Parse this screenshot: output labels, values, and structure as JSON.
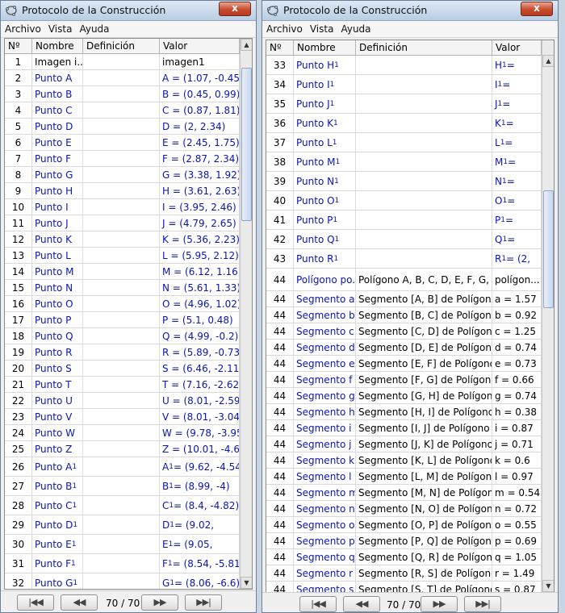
{
  "left_window": {
    "title": "Protocolo de la Construcción",
    "close_label": "x",
    "menu": [
      "Archivo",
      "Vista",
      "Ayuda"
    ],
    "columns": [
      "Nº",
      "Nombre",
      "Definición",
      "Valor"
    ],
    "rows": [
      {
        "n": "1",
        "name": "Imagen i...",
        "base": "",
        "sub": "",
        "def": "",
        "val": "imagen1",
        "vbase": "",
        "vrest": ""
      },
      {
        "n": "2",
        "name": "Punto A",
        "base": "",
        "sub": "",
        "def": "",
        "val": "A = (1.07, -0.45)",
        "vbase": "",
        "vrest": ""
      },
      {
        "n": "3",
        "name": "Punto B",
        "base": "",
        "sub": "",
        "def": "",
        "val": "B = (0.45, 0.99)",
        "vbase": "",
        "vrest": ""
      },
      {
        "n": "4",
        "name": "Punto C",
        "base": "",
        "sub": "",
        "def": "",
        "val": "C = (0.87, 1.81)",
        "vbase": "",
        "vrest": ""
      },
      {
        "n": "5",
        "name": "Punto D",
        "base": "",
        "sub": "",
        "def": "",
        "val": "D = (2, 2.34)",
        "vbase": "",
        "vrest": ""
      },
      {
        "n": "6",
        "name": "Punto E",
        "base": "",
        "sub": "",
        "def": "",
        "val": "E = (2.45, 1.75)",
        "vbase": "",
        "vrest": ""
      },
      {
        "n": "7",
        "name": "Punto F",
        "base": "",
        "sub": "",
        "def": "",
        "val": "F = (2.87, 2.34)",
        "vbase": "",
        "vrest": ""
      },
      {
        "n": "8",
        "name": "Punto G",
        "base": "",
        "sub": "",
        "def": "",
        "val": "G = (3.38, 1.92)",
        "vbase": "",
        "vrest": ""
      },
      {
        "n": "9",
        "name": "Punto H",
        "base": "",
        "sub": "",
        "def": "",
        "val": "H = (3.61, 2.63)",
        "vbase": "",
        "vrest": ""
      },
      {
        "n": "10",
        "name": "Punto I",
        "base": "",
        "sub": "",
        "def": "",
        "val": "I = (3.95, 2.46)",
        "vbase": "",
        "vrest": ""
      },
      {
        "n": "11",
        "name": "Punto J",
        "base": "",
        "sub": "",
        "def": "",
        "val": "J = (4.79, 2.65)",
        "vbase": "",
        "vrest": ""
      },
      {
        "n": "12",
        "name": "Punto K",
        "base": "",
        "sub": "",
        "def": "",
        "val": "K = (5.36, 2.23)",
        "vbase": "",
        "vrest": ""
      },
      {
        "n": "13",
        "name": "Punto L",
        "base": "",
        "sub": "",
        "def": "",
        "val": "L = (5.95, 2.12)",
        "vbase": "",
        "vrest": ""
      },
      {
        "n": "14",
        "name": "Punto M",
        "base": "",
        "sub": "",
        "def": "",
        "val": "M = (6.12, 1.16)",
        "vbase": "",
        "vrest": ""
      },
      {
        "n": "15",
        "name": "Punto N",
        "base": "",
        "sub": "",
        "def": "",
        "val": "N = (5.61, 1.33)",
        "vbase": "",
        "vrest": ""
      },
      {
        "n": "16",
        "name": "Punto O",
        "base": "",
        "sub": "",
        "def": "",
        "val": "O = (4.96, 1.02)",
        "vbase": "",
        "vrest": ""
      },
      {
        "n": "17",
        "name": "Punto P",
        "base": "",
        "sub": "",
        "def": "",
        "val": "P = (5.1, 0.48)",
        "vbase": "",
        "vrest": ""
      },
      {
        "n": "18",
        "name": "Punto Q",
        "base": "",
        "sub": "",
        "def": "",
        "val": "Q = (4.99, -0.2)",
        "vbase": "",
        "vrest": ""
      },
      {
        "n": "19",
        "name": "Punto R",
        "base": "",
        "sub": "",
        "def": "",
        "val": "R = (5.89, -0.73)",
        "vbase": "",
        "vrest": ""
      },
      {
        "n": "20",
        "name": "Punto S",
        "base": "",
        "sub": "",
        "def": "",
        "val": "S = (6.46, -2.11)",
        "vbase": "",
        "vrest": ""
      },
      {
        "n": "21",
        "name": "Punto T",
        "base": "",
        "sub": "",
        "def": "",
        "val": "T = (7.16, -2.62)",
        "vbase": "",
        "vrest": ""
      },
      {
        "n": "22",
        "name": "Punto U",
        "base": "",
        "sub": "",
        "def": "",
        "val": "U = (8.01, -2.59)",
        "vbase": "",
        "vrest": ""
      },
      {
        "n": "23",
        "name": "Punto V",
        "base": "",
        "sub": "",
        "def": "",
        "val": "V = (8.01, -3.04)",
        "vbase": "",
        "vrest": ""
      },
      {
        "n": "24",
        "name": "Punto W",
        "base": "",
        "sub": "",
        "def": "",
        "val": "W = (9.78, -3.95)",
        "vbase": "",
        "vrest": ""
      },
      {
        "n": "25",
        "name": "Punto Z",
        "base": "",
        "sub": "",
        "def": "",
        "val": "Z = (10.01, -4.6)",
        "vbase": "",
        "vrest": ""
      },
      {
        "n": "26",
        "name": "",
        "base": "Punto A",
        "sub": "1",
        "def": "",
        "val": "",
        "vbase": "A",
        "vrest": " = (9.62, -4.54)"
      },
      {
        "n": "27",
        "name": "",
        "base": "Punto B",
        "sub": "1",
        "def": "",
        "val": "",
        "vbase": "B",
        "vrest": " = (8.99, -4)"
      },
      {
        "n": "28",
        "name": "",
        "base": "Punto C",
        "sub": "1",
        "def": "",
        "val": "",
        "vbase": "C",
        "vrest": " = (8.4, -4.82)"
      },
      {
        "n": "29",
        "name": "",
        "base": "Punto D",
        "sub": "1",
        "def": "",
        "val": "",
        "vbase": "D",
        "vrest": " = (9.02,"
      },
      {
        "n": "30",
        "name": "",
        "base": "Punto E",
        "sub": "1",
        "def": "",
        "val": "",
        "vbase": "E",
        "vrest": " = (9.05,"
      },
      {
        "n": "31",
        "name": "",
        "base": "Punto F",
        "sub": "1",
        "def": "",
        "val": "",
        "vbase": "F",
        "vrest": " = (8.54, -5.81)"
      },
      {
        "n": "32",
        "name": "",
        "base": "Punto G",
        "sub": "1",
        "def": "",
        "val": "",
        "vbase": "G",
        "vrest": " = (8.06, -6.6)"
      }
    ],
    "nav": {
      "first": "|◀◀",
      "prev": "◀◀",
      "counter": "70 / 70",
      "next": "▶▶",
      "last": "▶▶|"
    }
  },
  "right_window": {
    "title": "Protocolo de la Construcción",
    "close_label": "x",
    "menu": [
      "Archivo",
      "Vista",
      "Ayuda"
    ],
    "columns": [
      "Nº",
      "Nombre",
      "Definición",
      "Valor"
    ],
    "rows": [
      {
        "n": "33",
        "name": "",
        "base": "Punto H",
        "sub": "1",
        "def": "",
        "val": "",
        "vbase": "H",
        "vrest": " ="
      },
      {
        "n": "34",
        "name": "",
        "base": "Punto I",
        "sub": "1",
        "def": "",
        "val": "",
        "vbase": "I",
        "vrest": " ="
      },
      {
        "n": "35",
        "name": "",
        "base": "Punto J",
        "sub": "1",
        "def": "",
        "val": "",
        "vbase": "J",
        "vrest": " ="
      },
      {
        "n": "36",
        "name": "",
        "base": "Punto K",
        "sub": "1",
        "def": "",
        "val": "",
        "vbase": "K",
        "vrest": " ="
      },
      {
        "n": "37",
        "name": "",
        "base": "Punto L",
        "sub": "1",
        "def": "",
        "val": "",
        "vbase": "L",
        "vrest": " ="
      },
      {
        "n": "38",
        "name": "",
        "base": "Punto M",
        "sub": "1",
        "def": "",
        "val": "",
        "vbase": "M",
        "vrest": " ="
      },
      {
        "n": "39",
        "name": "",
        "base": "Punto N",
        "sub": "1",
        "def": "",
        "val": "",
        "vbase": "N",
        "vrest": " ="
      },
      {
        "n": "40",
        "name": "",
        "base": "Punto O",
        "sub": "1",
        "def": "",
        "val": "",
        "vbase": "O",
        "vrest": " ="
      },
      {
        "n": "41",
        "name": "",
        "base": "Punto P",
        "sub": "1",
        "def": "",
        "val": "",
        "vbase": "P",
        "vrest": " ="
      },
      {
        "n": "42",
        "name": "",
        "base": "Punto Q",
        "sub": "1",
        "def": "",
        "val": "",
        "vbase": "Q",
        "vrest": " ="
      },
      {
        "n": "43",
        "name": "",
        "base": "Punto R",
        "sub": "1",
        "def": "",
        "val": "",
        "vbase": "R",
        "vrest": " = (2,"
      },
      {
        "n": "44",
        "name": "Polígono po...",
        "base": "",
        "sub": "",
        "def": "Polígono A, B, C, D, E, F, G, H,",
        "val": "polígon...",
        "vbase": "",
        "vrest": ""
      },
      {
        "n": "44",
        "name": "Segmento a",
        "base": "",
        "sub": "",
        "def": "Segmento [A, B] de Polígono",
        "val": "a = 1.57",
        "vbase": "",
        "vrest": ""
      },
      {
        "n": "44",
        "name": "Segmento b",
        "base": "",
        "sub": "",
        "def": "Segmento [B, C] de Polígono",
        "val": "b = 0.92",
        "vbase": "",
        "vrest": ""
      },
      {
        "n": "44",
        "name": "Segmento c",
        "base": "",
        "sub": "",
        "def": "Segmento [C, D] de Polígono",
        "val": "c = 1.25",
        "vbase": "",
        "vrest": ""
      },
      {
        "n": "44",
        "name": "Segmento d",
        "base": "",
        "sub": "",
        "def": "Segmento [D, E] de Polígono",
        "val": "d = 0.74",
        "vbase": "",
        "vrest": ""
      },
      {
        "n": "44",
        "name": "Segmento e",
        "base": "",
        "sub": "",
        "def": "Segmento [E, F] de Polígono",
        "val": "e = 0.73",
        "vbase": "",
        "vrest": ""
      },
      {
        "n": "44",
        "name": "Segmento f",
        "base": "",
        "sub": "",
        "def": "Segmento [F, G] de Polígono",
        "val": "f = 0.66",
        "vbase": "",
        "vrest": ""
      },
      {
        "n": "44",
        "name": "Segmento g",
        "base": "",
        "sub": "",
        "def": "Segmento [G, H] de Polígono",
        "val": "g = 0.74",
        "vbase": "",
        "vrest": ""
      },
      {
        "n": "44",
        "name": "Segmento h",
        "base": "",
        "sub": "",
        "def": "Segmento [H, I] de Polígono",
        "val": "h = 0.38",
        "vbase": "",
        "vrest": ""
      },
      {
        "n": "44",
        "name": "Segmento i",
        "base": "",
        "sub": "",
        "def": "Segmento [I, J] de Polígono",
        "val": "i = 0.87",
        "vbase": "",
        "vrest": ""
      },
      {
        "n": "44",
        "name": "Segmento j",
        "base": "",
        "sub": "",
        "def": "Segmento [J, K] de Polígono",
        "val": "j = 0.71",
        "vbase": "",
        "vrest": ""
      },
      {
        "n": "44",
        "name": "Segmento k",
        "base": "",
        "sub": "",
        "def": "Segmento [K, L] de Polígono",
        "val": "k = 0.6",
        "vbase": "",
        "vrest": ""
      },
      {
        "n": "44",
        "name": "Segmento l",
        "base": "",
        "sub": "",
        "def": "Segmento [L, M] de Polígono",
        "val": "l = 0.97",
        "vbase": "",
        "vrest": ""
      },
      {
        "n": "44",
        "name": "Segmento m",
        "base": "",
        "sub": "",
        "def": "Segmento [M, N] de Polígono",
        "val": "m = 0.54",
        "vbase": "",
        "vrest": ""
      },
      {
        "n": "44",
        "name": "Segmento n",
        "base": "",
        "sub": "",
        "def": "Segmento [N, O] de Polígono",
        "val": "n = 0.72",
        "vbase": "",
        "vrest": ""
      },
      {
        "n": "44",
        "name": "Segmento o",
        "base": "",
        "sub": "",
        "def": "Segmento [O, P] de Polígono",
        "val": "o = 0.55",
        "vbase": "",
        "vrest": ""
      },
      {
        "n": "44",
        "name": "Segmento p",
        "base": "",
        "sub": "",
        "def": "Segmento [P, Q] de Polígono",
        "val": "p = 0.69",
        "vbase": "",
        "vrest": ""
      },
      {
        "n": "44",
        "name": "Segmento q",
        "base": "",
        "sub": "",
        "def": "Segmento [Q, R] de Polígono",
        "val": "q = 1.05",
        "vbase": "",
        "vrest": ""
      },
      {
        "n": "44",
        "name": "Segmento r",
        "base": "",
        "sub": "",
        "def": "Segmento [R, S] de Polígono",
        "val": "r = 1.49",
        "vbase": "",
        "vrest": ""
      },
      {
        "n": "44",
        "name": "Segmento s",
        "base": "",
        "sub": "",
        "def": "Segmento [S, T] de Polígono",
        "val": "s = 0.87",
        "vbase": "",
        "vrest": ""
      }
    ],
    "nav": {
      "first": "|◀◀",
      "prev": "◀◀",
      "counter": "70 / 70",
      "next": "▶▶",
      "last": "▶▶|"
    }
  }
}
